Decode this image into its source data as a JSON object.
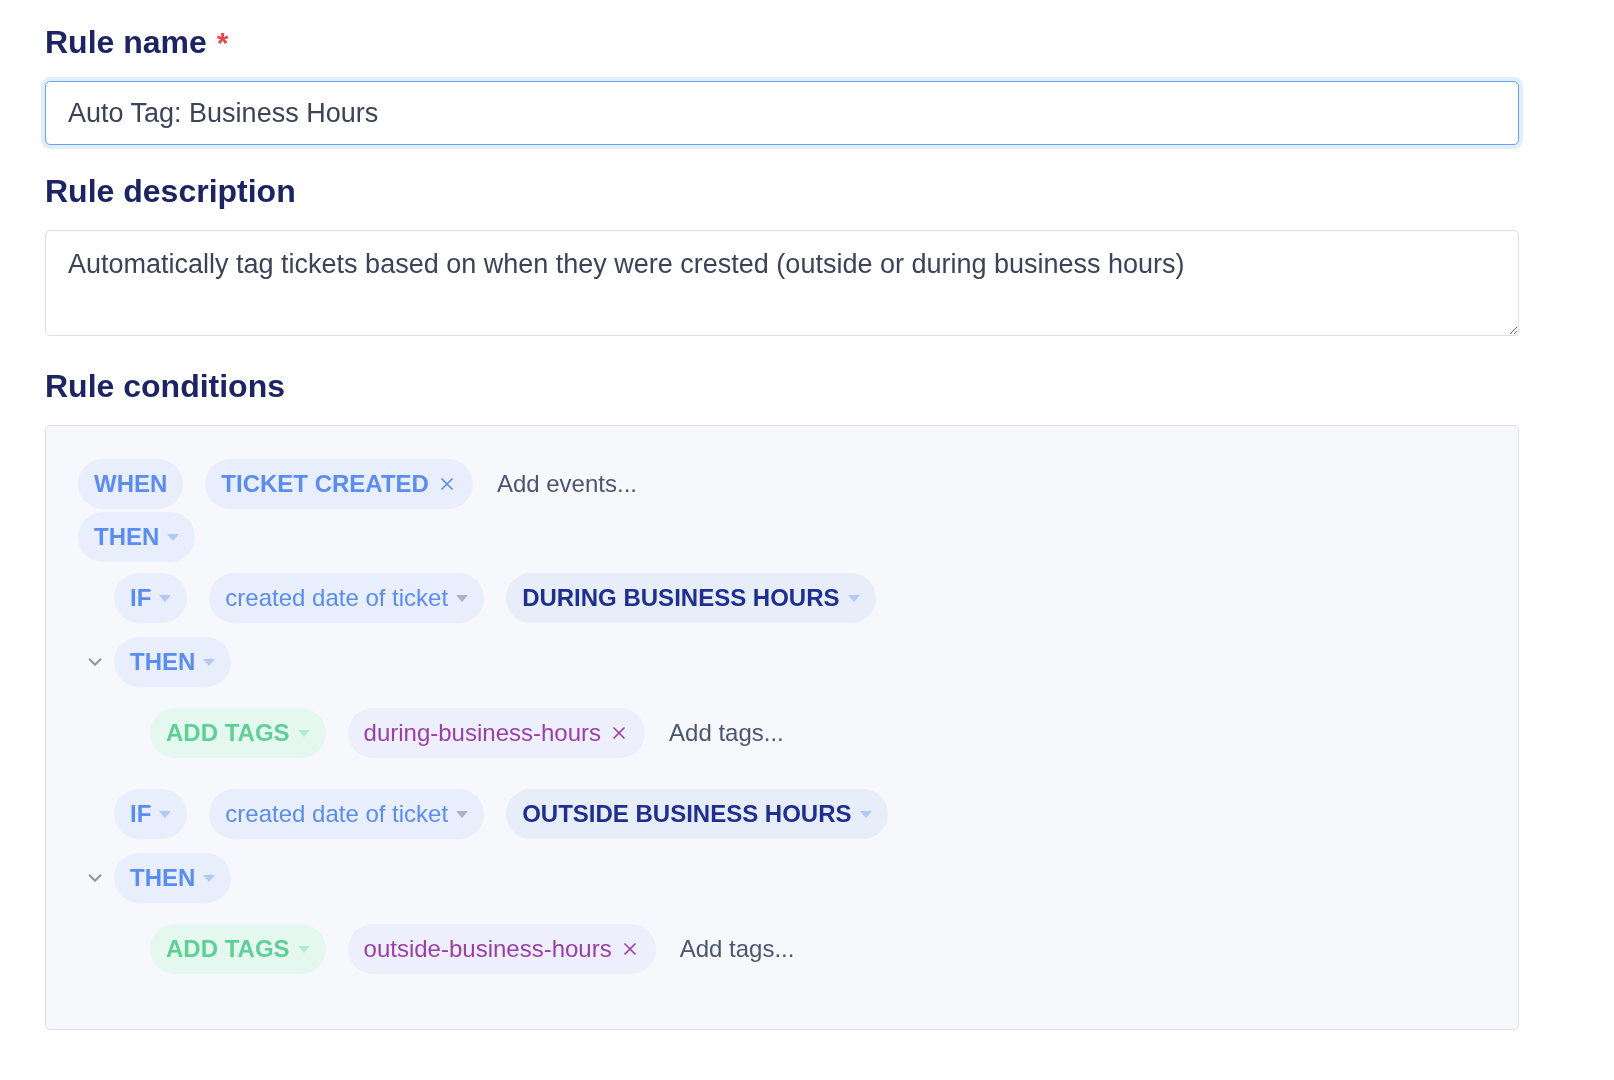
{
  "rule_name": {
    "label": "Rule name",
    "required_mark": "*",
    "value": "Auto Tag: Business Hours",
    "focused": true
  },
  "rule_description": {
    "label": "Rule description",
    "value": "Automatically tag tickets based on when they were crested (outside or during business hours)"
  },
  "rule_conditions": {
    "label": "Rule conditions",
    "when": {
      "keyword": "WHEN",
      "events": [
        {
          "label": "TICKET CREATED"
        }
      ],
      "placeholder": "Add events..."
    },
    "then": {
      "keyword": "THEN"
    },
    "branches": [
      {
        "if_keyword": "IF",
        "field": "created date of ticket",
        "value": "DURING BUSINESS HOURS",
        "then_keyword": "THEN",
        "expanded": true,
        "action": {
          "keyword": "ADD TAGS",
          "tags": [
            {
              "label": "during-business-hours"
            }
          ],
          "placeholder": "Add tags..."
        }
      },
      {
        "if_keyword": "IF",
        "field": "created date of ticket",
        "value": "OUTSIDE BUSINESS HOURS",
        "then_keyword": "THEN",
        "expanded": true,
        "action": {
          "keyword": "ADD TAGS",
          "tags": [
            {
              "label": "outside-business-hours"
            }
          ],
          "placeholder": "Add tags..."
        }
      }
    ]
  }
}
